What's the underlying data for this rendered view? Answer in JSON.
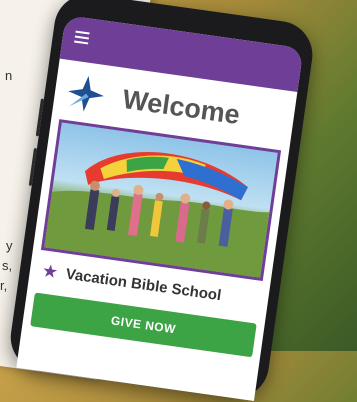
{
  "app": {
    "heading": "Welcome",
    "menu_icon": "hamburger-menu-icon",
    "logo_icon": "church-logo-icon"
  },
  "photo": {
    "subject": "children-parachute-photo"
  },
  "event": {
    "icon": "star-icon",
    "label": "Vacation Bible School"
  },
  "cta": {
    "label": "GIVE NOW"
  },
  "colors": {
    "appbar": "#6f3f97",
    "button": "#3da445",
    "accent": "#6f3f97"
  },
  "background_paper": {
    "fragments": [
      "n",
      "y",
      "s,",
      "r,"
    ]
  }
}
